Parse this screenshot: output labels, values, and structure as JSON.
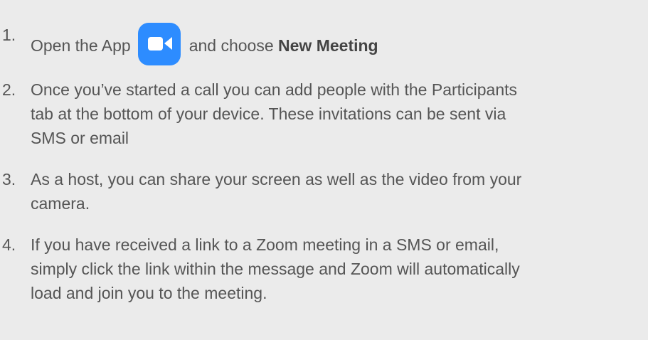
{
  "steps": [
    {
      "number": "1.",
      "text_before": "Open the App",
      "icon": "zoom-camera-icon",
      "text_middle": "and choose",
      "strong": "New Meeting"
    },
    {
      "number": "2.",
      "lines": [
        "Once you’ve started a call you can add people with the Participants",
        "tab at the bottom of your device. These invitations can be sent via",
        "SMS or email"
      ]
    },
    {
      "number": "3.",
      "lines": [
        "As a host, you can share your screen as well as the video from your",
        "camera."
      ]
    },
    {
      "number": "4.",
      "lines": [
        "If you have received a link to a Zoom meeting in a SMS or email,",
        "simply click the link within the message and Zoom will automatically",
        "load and join you to the meeting."
      ]
    }
  ],
  "colors": {
    "background": "#ebebeb",
    "text": "#555555",
    "icon_bg": "#2d8cff"
  }
}
